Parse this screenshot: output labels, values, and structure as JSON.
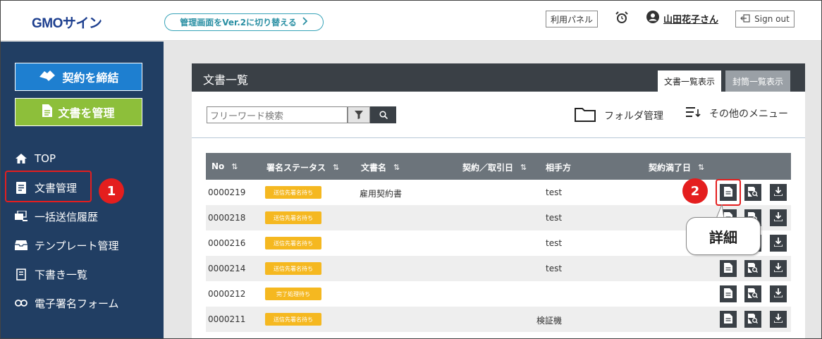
{
  "header": {
    "logo": "GMOサイン",
    "switch_label": "管理画面をVer.2に切り替える",
    "panel_label": "利用パネル",
    "user_name": "山田花子さん",
    "signout_label": "Sign out"
  },
  "sidebar": {
    "sign_button": "契約を締結",
    "manage_button": "文書を管理",
    "items": [
      {
        "label": "TOP",
        "icon": "home-icon"
      },
      {
        "label": "文書管理",
        "icon": "document-icon"
      },
      {
        "label": "一括送信履歴",
        "icon": "bulk-send-icon"
      },
      {
        "label": "テンプレート管理",
        "icon": "template-icon"
      },
      {
        "label": "下書き一覧",
        "icon": "draft-icon"
      },
      {
        "label": "電子署名フォーム",
        "icon": "link-icon"
      }
    ]
  },
  "annotations": {
    "step1": "1",
    "step2": "2",
    "tooltip": "詳細"
  },
  "main": {
    "title": "文書一覧",
    "tabs": [
      {
        "label": "文書一覧表示",
        "active": true
      },
      {
        "label": "封筒一覧表示",
        "active": false
      }
    ],
    "search_placeholder": "フリーワード検索",
    "folder_label": "フォルダ管理",
    "other_menu_label": "その他のメニュー",
    "columns": [
      "No",
      "署名ステータス",
      "文書名",
      "契約／取引日",
      "相手方",
      "契約満了日"
    ],
    "rows": [
      {
        "no": "0000219",
        "status": "送信先署名待ち",
        "name": "雇用契約書",
        "date": "",
        "partner": "test",
        "expiry": ""
      },
      {
        "no": "0000218",
        "status": "送信先署名待ち",
        "name": "",
        "date": "",
        "partner": "test",
        "expiry": ""
      },
      {
        "no": "0000216",
        "status": "送信先署名待ち",
        "name": "",
        "date": "",
        "partner": "test",
        "expiry": ""
      },
      {
        "no": "0000214",
        "status": "送信先署名待ち",
        "name": "",
        "date": "",
        "partner": "test",
        "expiry": ""
      },
      {
        "no": "0000212",
        "status": "完了処理待ち",
        "name": "",
        "date": "",
        "partner": "",
        "expiry": ""
      },
      {
        "no": "0000211",
        "status": "送信先署名待ち",
        "name": "",
        "date": "",
        "partner": "検証機",
        "expiry": ""
      }
    ]
  },
  "colors": {
    "sidebar": "#213e63",
    "sign_button": "#1e7fd0",
    "manage_button": "#8dbf3a",
    "status_badge": "#f5b820",
    "highlight": "#e41e1e"
  }
}
